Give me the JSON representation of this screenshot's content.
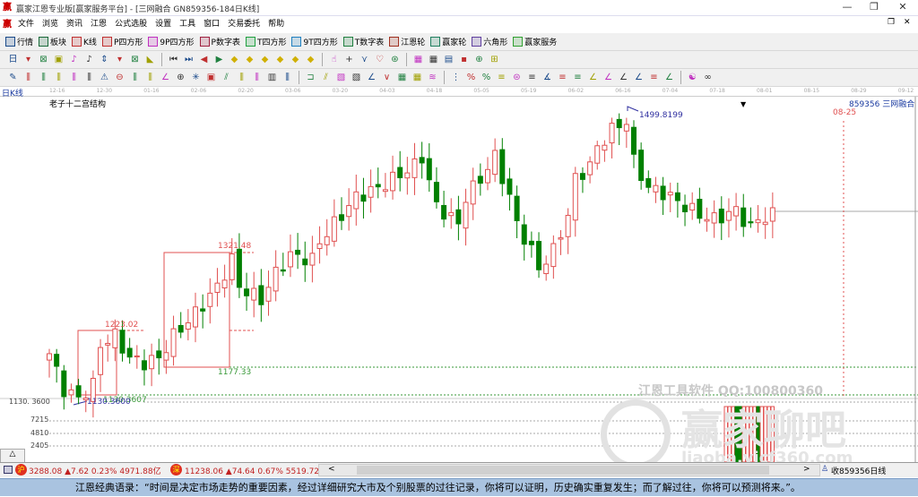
{
  "window": {
    "title": "赢家江恩专业版[赢家服务平台] - [三网融合  GN859356-184日K线]",
    "controls": [
      "—",
      "❐",
      "✕"
    ]
  },
  "menu": [
    "文件",
    "浏览",
    "资讯",
    "江恩",
    "公式选股",
    "设置",
    "工具",
    "窗口",
    "交易委托",
    "帮助"
  ],
  "toolbar1": [
    {
      "label": "行情",
      "icon": "grid-icon",
      "color": "#1a4a8a"
    },
    {
      "label": "板块",
      "icon": "block-icon",
      "color": "#1a6a3a"
    },
    {
      "label": "K线",
      "icon": "kline-icon",
      "color": "#c03030"
    },
    {
      "label": "P四方形",
      "icon": "p-square-icon",
      "color": "#c03030"
    },
    {
      "label": "9P四方形",
      "icon": "9p-square-icon",
      "color": "#c030c0"
    },
    {
      "label": "P数字表",
      "icon": "p-table-icon",
      "color": "#a02040"
    },
    {
      "label": "T四方形",
      "icon": "t-square-icon",
      "color": "#20a040"
    },
    {
      "label": "9T四方形",
      "icon": "9t-square-icon",
      "color": "#2080c0"
    },
    {
      "label": "T数字表",
      "icon": "t-table-icon",
      "color": "#208040"
    },
    {
      "label": "江恩轮",
      "icon": "gann-wheel-icon",
      "color": "#a03020"
    },
    {
      "label": "赢家轮",
      "icon": "winner-wheel-icon",
      "color": "#208060"
    },
    {
      "label": "六角形",
      "icon": "hexagon-icon",
      "color": "#6040a0"
    },
    {
      "label": "赢家服务",
      "icon": "dollar-icon",
      "color": "#30a030"
    }
  ],
  "toolbar2": [
    "日",
    "▾",
    "⊠",
    "▣",
    "♪",
    "♪",
    "⇕",
    "▾",
    "⊠",
    "◣",
    "|",
    "⏮",
    "⏭",
    "◀",
    "▶",
    "◆",
    "◆",
    "◆",
    "◆",
    "◆",
    "◆",
    "|",
    "☝",
    "+",
    "⋎",
    "♡",
    "⊛",
    "|",
    "▦",
    "▦",
    "▤",
    "▪",
    "⊕",
    "⊞"
  ],
  "toolbar3": [
    "✎",
    "⫼",
    "⫼",
    "⫼",
    "⫼",
    "⫼",
    "⚠",
    "⊖",
    "⫼",
    "⫼",
    "∠",
    "⊕",
    "✳",
    "▣",
    "⫽",
    "⫼",
    "⫼",
    "▥",
    "⫼",
    "|",
    "⊐",
    "⫽",
    "▧",
    "▧",
    "∠",
    "∨",
    "▦",
    "▦",
    "≋",
    "|",
    "⋮",
    "%",
    "%",
    "≡",
    "⊜",
    "≡",
    "∡",
    "≡",
    "≡",
    "∠",
    "∠",
    "∠",
    "∠",
    "≡",
    "∠",
    "|",
    "☯",
    "∞"
  ],
  "chart": {
    "period_label": "日K线",
    "indicator_name": "老子十二宫结构",
    "dates": [
      "12-16",
      "12-30",
      "01-16",
      "02-06",
      "02-20",
      "03-06",
      "03-20",
      "04-03",
      "04-18",
      "05-05",
      "05-19",
      "06-02",
      "06-16",
      "07-04",
      "07-18",
      "08-01",
      "08-15",
      "08-29",
      "09-12"
    ],
    "symbol_label": "859356 三网融合",
    "marker_date": "08-25",
    "high_label": "1499.8199",
    "low_label": "1130.3600",
    "low_label2": "1130.3607",
    "axis_price_label": "1130. 3600",
    "box1_top": "1223.02",
    "box2_top": "1321.48",
    "box2_bottom": "1177.33",
    "volume_ticks": [
      "7215",
      "4810",
      "2405"
    ],
    "watermark": "江恩工具软件  QQ:100800360",
    "watermark2": "赢家聊吧",
    "watermark3": "liaoba.yicf360.com",
    "close_anchors": [
      [
        0,
        1194.6
      ],
      [
        2,
        1149.5
      ],
      [
        4,
        1138.2
      ],
      [
        6,
        1155.1
      ],
      [
        7,
        1205.8
      ],
      [
        9,
        1217.1
      ],
      [
        11,
        1188.9
      ],
      [
        13,
        1183.3
      ],
      [
        15,
        1188.9
      ],
      [
        17,
        1217.1
      ],
      [
        20,
        1245.3
      ],
      [
        23,
        1279.0
      ],
      [
        25,
        1312.8
      ],
      [
        26,
        1279.0
      ],
      [
        29,
        1262.2
      ],
      [
        31,
        1296.0
      ],
      [
        33,
        1318.5
      ],
      [
        36,
        1312.8
      ],
      [
        37,
        1335.3
      ],
      [
        40,
        1369.2
      ],
      [
        42,
        1391.7
      ],
      [
        45,
        1402.9
      ],
      [
        47,
        1414.2
      ],
      [
        50,
        1431.1
      ],
      [
        51,
        1442.4
      ],
      [
        53,
        1380.4
      ],
      [
        56,
        1357.9
      ],
      [
        57,
        1391.7
      ],
      [
        59,
        1414.2
      ],
      [
        61,
        1442.4
      ],
      [
        63,
        1391.7
      ],
      [
        64,
        1357.9
      ],
      [
        66,
        1324.1
      ],
      [
        67,
        1301.6
      ],
      [
        69,
        1324.1
      ],
      [
        71,
        1369.2
      ],
      [
        72,
        1414.2
      ],
      [
        74,
        1431.1
      ],
      [
        75,
        1453.6
      ],
      [
        77,
        1476.2
      ],
      [
        79,
        1487.4
      ],
      [
        80,
        1436.7
      ],
      [
        82,
        1402.9
      ],
      [
        84,
        1397.3
      ],
      [
        86,
        1386.1
      ],
      [
        89,
        1369.2
      ],
      [
        91,
        1363.5
      ],
      [
        94,
        1374.8
      ],
      [
        96,
        1352.2
      ],
      [
        97,
        1363.5
      ],
      [
        99,
        1369.2
      ]
    ],
    "colors": {
      "up": "#e05050",
      "down": "#008000",
      "box": "#e05050"
    }
  },
  "status": {
    "sh_index": "3288.08 ▲7.62 0.23% 4971.88亿",
    "sz_index": "11238.06 ▲74.64 0.67% 5519.72亿",
    "sh_badge": "沪",
    "sz_badge": "深",
    "right": "收859356日线",
    "scroll_left": "<",
    "scroll_right": ">",
    "panel_toggle": "△"
  },
  "quote": "江恩经典语录：“时间是决定市场走势的重要因素，经过详细研究大市及个别股票的过往记录，你将可以证明，历史确实重复发生；而了解过往，你将可以预测将来。”。"
}
